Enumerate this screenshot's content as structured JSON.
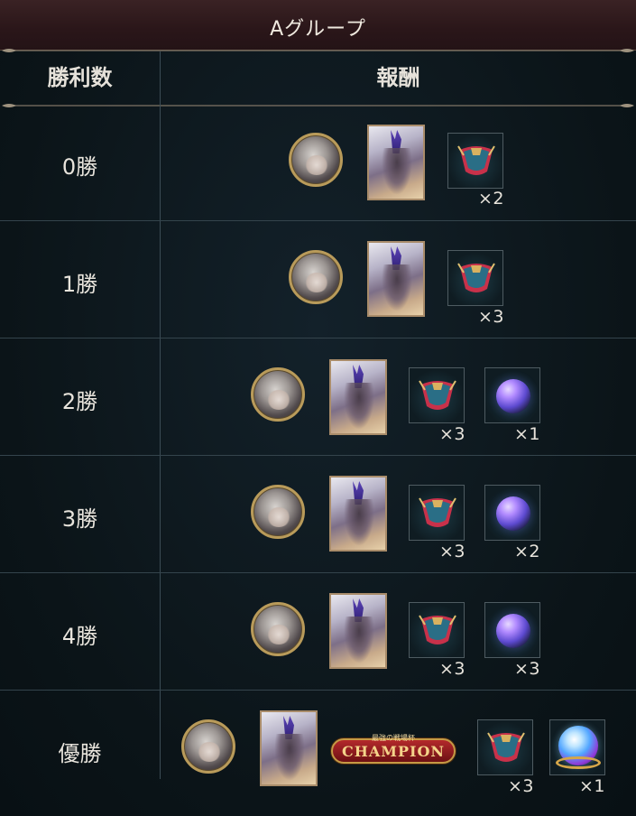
{
  "header": {
    "title": "Aグループ"
  },
  "table": {
    "col_wins": "勝利数",
    "col_rewards": "報酬",
    "rows": [
      {
        "label": "0勝"
      },
      {
        "label": "1勝"
      },
      {
        "label": "2勝"
      },
      {
        "label": "3勝"
      },
      {
        "label": "4勝"
      },
      {
        "label": "優勝"
      }
    ]
  },
  "quantities": {
    "r0_emblem": "×2",
    "r1_emblem": "×3",
    "r2_emblem": "×3",
    "r2_gem": "×1",
    "r3_emblem": "×3",
    "r3_gem": "×2",
    "r4_emblem": "×3",
    "r4_gem": "×3",
    "r5_emblem": "×3",
    "r5_orb": "×1"
  },
  "champion": {
    "sub": "最強の戦場杯",
    "label": "CHAMPION"
  },
  "colors": {
    "header_bg": "#2a1619",
    "background": "#0b1418",
    "frame_gold": "#b99b5a",
    "accent_red": "#b3292b"
  },
  "icons": [
    "character-avatar-icon",
    "character-card-icon",
    "emblem-icon",
    "crystal-gem-icon",
    "orb-icon",
    "champion-badge-icon"
  ]
}
